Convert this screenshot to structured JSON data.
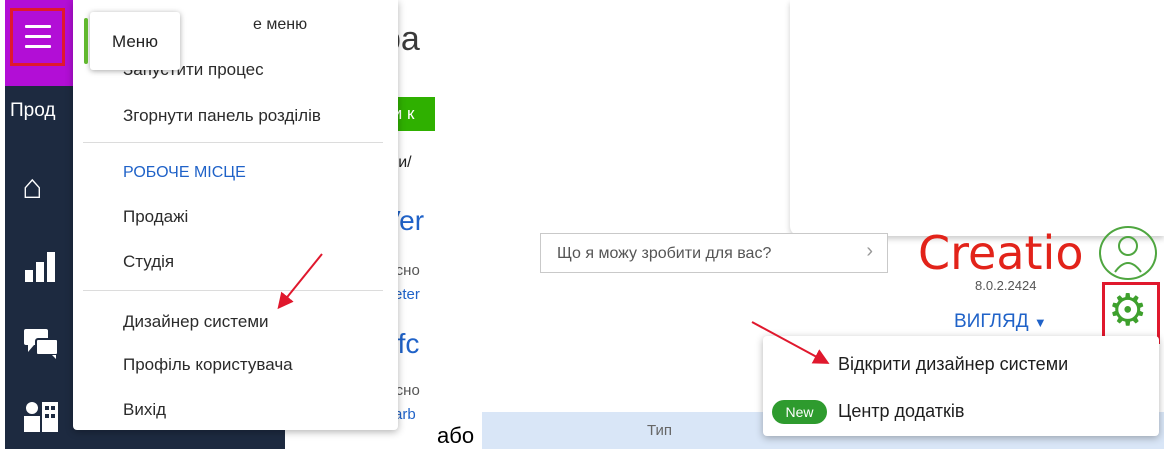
{
  "sidebar": {
    "section_label": "Прод",
    "icons": [
      "home-icon",
      "chart-bar-icon",
      "chat-icon",
      "contacts-icon"
    ]
  },
  "background_app": {
    "title_fragment": "pa",
    "green_button_fragment": "ти к",
    "filter_fragment": "три/",
    "items": [
      {
        "title": "Ver",
        "sub": "Осно",
        "link": "Peter"
      },
      {
        "title": "nfc",
        "sub": "Осно",
        "link": "Barb"
      }
    ],
    "table_column": "Тип"
  },
  "main_menu": {
    "tooltip_label": "Меню",
    "first_item_fragment": "е меню",
    "items_top": [
      "Запустити процес",
      "Згорнути панель розділів"
    ],
    "section_header": "РОБОЧЕ МІСЦЕ",
    "workplaces": [
      "Продажі",
      "Студія"
    ],
    "items_bottom": [
      "Дизайнер системи",
      "Профіль користувача",
      "Вихід"
    ]
  },
  "separator_text": "або",
  "right_panel": {
    "search_placeholder": "Що я можу зробити для вас?",
    "logo": "Creatio",
    "version": "8.0.2.2424",
    "view_label": "ВИГЛЯД",
    "dropdown": {
      "open_designer": "Відкрити дизайнер системи",
      "new_badge": "New",
      "marketplace": "Центр додатків"
    }
  },
  "colors": {
    "accent_red": "#e0182d",
    "sidebar_bg": "#1d2a40",
    "header_purple": "#b20ed6",
    "link_blue": "#1f62c8",
    "green": "#3ea02d"
  }
}
